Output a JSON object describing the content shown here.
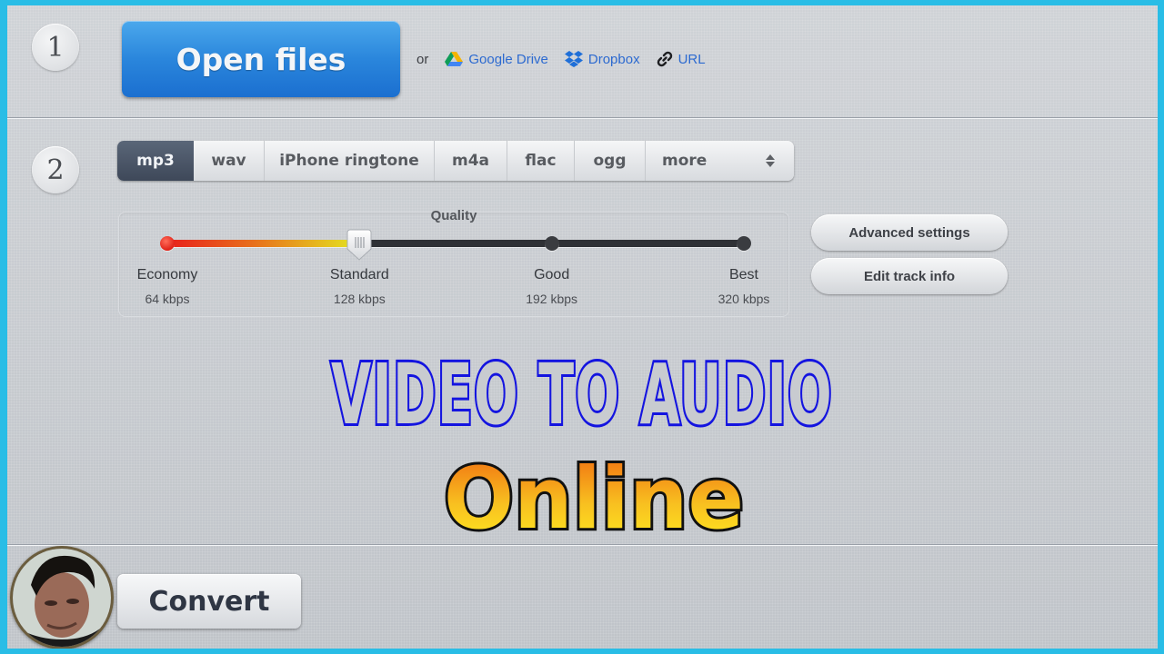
{
  "step1": {
    "number": "1",
    "open_files_label": "Open files",
    "or_label": "or",
    "links": [
      {
        "label": "Google Drive",
        "icon": "google-drive-icon"
      },
      {
        "label": "Dropbox",
        "icon": "dropbox-icon"
      },
      {
        "label": "URL",
        "icon": "link-icon"
      }
    ]
  },
  "step2": {
    "number": "2",
    "formats": [
      {
        "label": "mp3",
        "active": true
      },
      {
        "label": "wav",
        "active": false
      },
      {
        "label": "iPhone ringtone",
        "active": false
      },
      {
        "label": "m4a",
        "active": false
      },
      {
        "label": "flac",
        "active": false
      },
      {
        "label": "ogg",
        "active": false
      }
    ],
    "more_label": "more",
    "quality": {
      "title": "Quality",
      "selected_index": 1,
      "levels": [
        {
          "label": "Economy",
          "bitrate": "64 kbps"
        },
        {
          "label": "Standard",
          "bitrate": "128 kbps"
        },
        {
          "label": "Good",
          "bitrate": "192 kbps"
        },
        {
          "label": "Best",
          "bitrate": "320 kbps"
        }
      ]
    },
    "advanced_settings_label": "Advanced settings",
    "edit_track_info_label": "Edit track info"
  },
  "overlay": {
    "headline": "VIDEO TO AUDIO",
    "subheadline": "Online"
  },
  "step3": {
    "convert_label": "Convert"
  },
  "colors": {
    "frame_border": "#29bde6",
    "primary_button": "#2a86dc",
    "link": "#2c6ad0",
    "active_format": "#3e4859",
    "headline_outline": "#1414e0",
    "headline_fill": "#c8cbd0"
  }
}
